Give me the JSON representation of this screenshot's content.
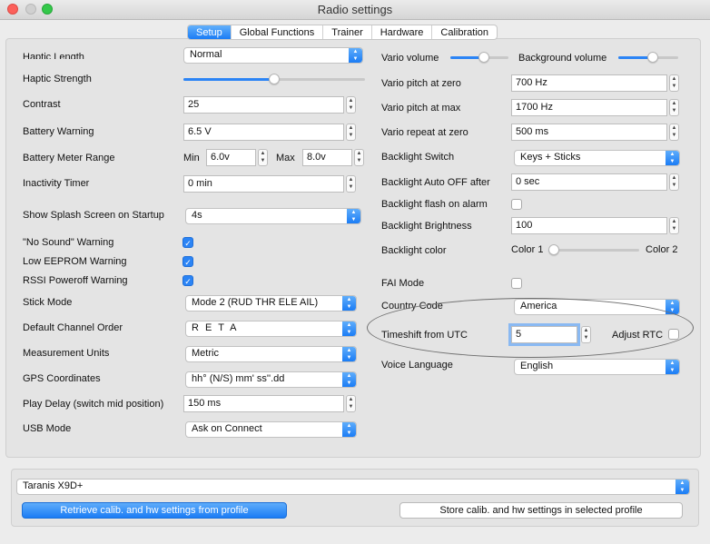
{
  "window": {
    "title": "Radio settings"
  },
  "tabs": [
    "Setup",
    "Global Functions",
    "Trainer",
    "Hardware",
    "Calibration"
  ],
  "left": {
    "haptic_length": {
      "label": "Haptic Length",
      "value": "Normal"
    },
    "haptic_strength": {
      "label": "Haptic Strength",
      "level": 0.5
    },
    "contrast": {
      "label": "Contrast",
      "value": "25"
    },
    "battery_warning": {
      "label": "Battery Warning",
      "value": "6.5 V"
    },
    "battery_meter_range": {
      "label": "Battery Meter Range",
      "min_label": "Min",
      "min_value": "6.0v",
      "max_label": "Max",
      "max_value": "8.0v"
    },
    "inactivity_timer": {
      "label": "Inactivity Timer",
      "value": "0 min"
    },
    "splash_screen": {
      "label": "Show Splash Screen on Startup",
      "value": "4s"
    },
    "no_sound_warning": {
      "label": "\"No Sound\" Warning",
      "checked": true
    },
    "low_eeprom_warning": {
      "label": "Low EEPROM Warning",
      "checked": true
    },
    "rssi_poweroff_warning": {
      "label": "RSSI Poweroff Warning",
      "checked": true
    },
    "stick_mode": {
      "label": "Stick Mode",
      "value": "Mode 2 (RUD THR ELE AIL)"
    },
    "default_channel_order": {
      "label": "Default Channel Order",
      "value": "R E T A"
    },
    "measurement_units": {
      "label": "Measurement Units",
      "value": "Metric"
    },
    "gps_coordinates": {
      "label": "GPS Coordinates",
      "value": "hh° (N/S) mm' ss''.dd"
    },
    "play_delay": {
      "label": "Play Delay (switch mid position)",
      "value": "150 ms"
    },
    "usb_mode": {
      "label": "USB Mode",
      "value": "Ask on Connect"
    }
  },
  "right": {
    "vario_volume": {
      "label": "Vario volume",
      "level": 0.6
    },
    "background_volume": {
      "label": "Background volume",
      "level": 0.6
    },
    "vario_pitch_zero": {
      "label": "Vario pitch at zero",
      "value": "700 Hz"
    },
    "vario_pitch_max": {
      "label": "Vario pitch at max",
      "value": "1700 Hz"
    },
    "vario_repeat_zero": {
      "label": "Vario repeat at zero",
      "value": "500 ms"
    },
    "backlight_switch": {
      "label": "Backlight Switch",
      "value": "Keys + Sticks"
    },
    "backlight_auto_off": {
      "label": "Backlight  Auto OFF after",
      "value": "0 sec"
    },
    "backlight_flash_alarm": {
      "label": "Backlight flash on alarm",
      "checked": false
    },
    "backlight_brightness": {
      "label": "Backlight Brightness",
      "value": "100"
    },
    "backlight_color": {
      "label": "Backlight color",
      "left_label": "Color 1",
      "right_label": "Color 2",
      "level": 0.0
    },
    "fai_mode": {
      "label": "FAI Mode",
      "checked": false
    },
    "country_code": {
      "label": "Country Code",
      "value": "America"
    },
    "timeshift_utc": {
      "label": "Timeshift from UTC",
      "value": "5"
    },
    "adjust_rtc": {
      "label": "Adjust RTC",
      "checked": false
    },
    "voice_language": {
      "label": "Voice Language",
      "value": "English"
    }
  },
  "bottom": {
    "radio_profile": "Taranis X9D+",
    "retrieve_button": "Retrieve calib. and hw settings from profile",
    "store_button": "Store calib. and hw settings in selected profile"
  },
  "colors": {
    "accent": "#1b7cf5",
    "annotation": "#6f6f6f"
  }
}
